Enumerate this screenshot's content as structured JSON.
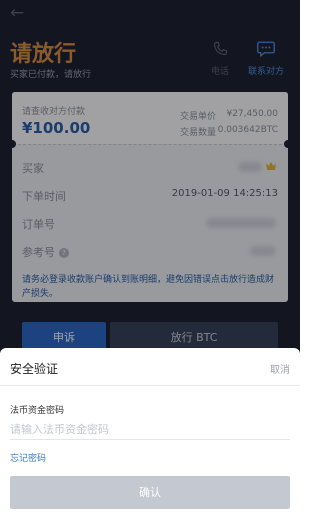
{
  "header": {
    "back_icon": "arrow-left-icon",
    "title": "请放行",
    "subtitle": "买家已付款，请放行",
    "call_label": "电话",
    "contact_label": "联系对方",
    "accent_color": "#d58a45",
    "link_color": "#4a90e2"
  },
  "order": {
    "pay_label": "请查收对方付款",
    "amount": "¥100.00",
    "unit_price_label": "交易单价",
    "unit_price": "¥27,450.00",
    "quantity_label": "交易数量",
    "quantity": "0.003642BTC",
    "buyer_label": "买家",
    "order_time_label": "下单时间",
    "order_time": "2019-01-09 14:25:13",
    "order_no_label": "订单号",
    "reference_label": "参考号",
    "help_glyph": "?",
    "warning": "请务必登录收款账户确认到账明细，避免因错误点击放行造成财产损失。"
  },
  "actions": {
    "appeal": "申诉",
    "release": "放行 BTC"
  },
  "dialog": {
    "title": "安全验证",
    "cancel": "取消",
    "field_label": "法币资金密码",
    "placeholder": "请输入法币资金密码",
    "forgot": "忘记密码",
    "confirm": "确认"
  }
}
